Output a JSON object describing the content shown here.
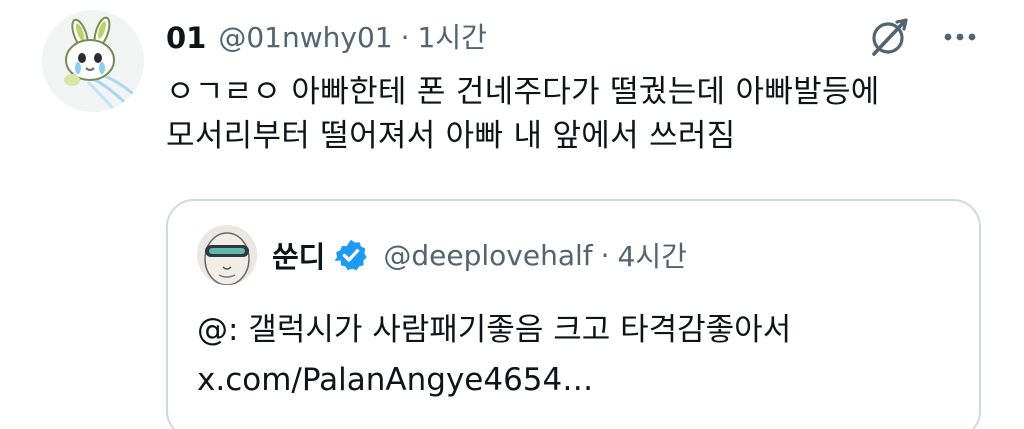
{
  "post": {
    "display_name": "01",
    "handle": "@01nwhy01",
    "separator": "·",
    "time": "1시간",
    "avatar_icon": "bunny-character-avatar-icon",
    "text_lines": [
      "ㅇㄱㄹㅇ 아빠한테 폰 건네주다가 떨궜는데 아빠발등에",
      "모서리부터 떨어져서 아빠 내 앞에서 쓰러짐"
    ]
  },
  "toolbar": {
    "grok_icon": "grok-icon",
    "more_icon": "more-dots-icon"
  },
  "quoted_post": {
    "display_name": "쑨디",
    "verified_icon": "verified-badge-icon",
    "handle": "@deeplovehalf",
    "separator": "·",
    "time": "4시간",
    "text_lines": [
      "@: 갤럭시가 사람패기좋음 크고 타격감좋아서",
      "x.com/PalanAngye4654…"
    ]
  },
  "colors": {
    "text_primary": "#0f1419",
    "text_secondary": "#536471",
    "border": "#cfd9de",
    "verified_blue": "#1d9bf0"
  }
}
